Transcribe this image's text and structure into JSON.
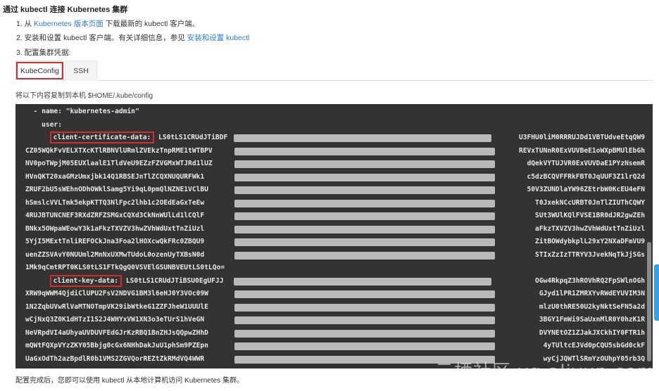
{
  "heading": "通过 kubectl 连接 Kubernetes 集群",
  "steps": [
    {
      "prefix": "1. 从 ",
      "link": "Kubernetes 版本页面",
      "suffix": " 下载最新的 kubectl 客户端。"
    },
    {
      "prefix": "2. 安装和设置 kubectl 客户端。有关详细信息，参见 ",
      "link": "安装和设置 kubectl",
      "suffix": ""
    },
    {
      "prefix": "3. 配置集群凭据:",
      "link": "",
      "suffix": ""
    }
  ],
  "tabs": [
    {
      "label": "KubeConfig",
      "active": true
    },
    {
      "label": "SSH",
      "active": false
    }
  ],
  "copy_hint": "将以下内容复制到本机 $HOME/.kube/config",
  "code": {
    "lines": [
      {
        "pre": "  - name: \"kubernetes-admin\"",
        "key": "",
        "start": "",
        "end": ""
      },
      {
        "pre": "    user:",
        "key": "",
        "start": "",
        "end": ""
      },
      {
        "pre": "      ",
        "key": "client-certificate-data:",
        "start": " LS0tLS1CRUdJTiBDF",
        "end": "U3FHU0liM0RRRUJDd1VBTUdveEtqQW9"
      },
      {
        "pre": "",
        "key": "",
        "start": "CZ05WQkFvVELXTXcKTlRBNVlURmlZVEkzTnpRME1tWTBPV",
        "end": "REVxTUNnR0ExVUVBeE1oWXpBMUlEbGh"
      },
      {
        "pre": "",
        "key": "",
        "start": "NV0poTWpjM05EUXlaalE1TldVeU9EZzFZVGMxWTJRd1lUZ",
        "end": "dQekVYTUJVR0ExVUVDaE1PYzNsemR"
      },
      {
        "pre": "",
        "key": "",
        "start": "HVnQKT20xaGMzUmxjbk14Q1RBSEJnTlZCQXNUQURFWk1",
        "end": "c5dzBCQVFFRkFBT0JqUUF3Z1lrQ2d"
      },
      {
        "pre": "",
        "key": "",
        "start": "ZRUF2bU5sWEhnODhOWklSamg5Yi9qL0pmQlNZNE1VClBU",
        "end": "50V3ZUNDlaYW96ZEtrbW0KcEU4eFN"
      },
      {
        "pre": "",
        "key": "",
        "start": "hSmslcVVLTmk5ekpKTTQ3NlFpc2lhb1c2OEdEaGxTeEw",
        "end": "T0JxekNCcURBT0JnTlZIUThCQWY"
      },
      {
        "pre": "",
        "key": "",
        "start": "4RUJBTUNCNEF3RXdZRFZSMGxCQXd3CkNnWUlLd1lCQlF",
        "end": "SUt3WUlKQlFVSE1BR0dJR2gwZEh"
      },
      {
        "pre": "",
        "key": "",
        "start": "BNkx5OWpaWEowY3k1aFkzTXVZV3hwZVhWdUxtTnZiUzl",
        "end": "aFkzTXVZV3hwZVhWdUxtTnZiUzl"
      },
      {
        "pre": "",
        "key": "",
        "start": "5YjI5MExtTnliREFOCkJna3Foa2lHOXcwQkFRc0ZBQU9",
        "end": "ZitBOWdybkplL29xY2NXaDFmVU9"
      },
      {
        "pre": "",
        "key": "",
        "start": "uenZZSVAvY0NUUml2MnNxUXMwTUdoL0ozenUyTXBsN0d",
        "end": "STIxZzIzTTRYV3JvekNqTkJjSGs"
      },
      {
        "pre": "",
        "key": "",
        "start": "1Mk9qCmtRPT0KLS0tLS1FTkQgQ0VSVElGSUNBVEUtLS0tLQo=",
        "end": ""
      },
      {
        "pre": "      ",
        "key": "client-key-data:",
        "start": " LS0tLS1CRUdJTiBSU0EgUFJJ",
        "end": "OGw4RkpqZ3hROVhRQ2FpSWlnOGh"
      },
      {
        "pre": "",
        "key": "",
        "start": "XRW9qWWM4QjdiClUPU2FsV2NDVG1BM3l6eHJ0Y3VOc09W",
        "end": "GJyd1lPR1ZMRXYvRWdEYUVIM3N"
      },
      {
        "pre": "",
        "key": "",
        "start": "1N2ZqbUVwRlVaMTNOTmpVK29ibWtkeG1ZZFJheW1UUUlE",
        "end": "mlzU0thRE50U2kyNktSeFN5a2d"
      },
      {
        "pre": "",
        "key": "",
        "start": "wCjNxQ3Z0K1dHTzI1S2J4WHYxVW1XN3o3eTUrS1hVeGN",
        "end": "3BGY1FmWi9SaUxnMlR0Y0hzK1R"
      },
      {
        "pre": "",
        "key": "",
        "start": "NeVRpdVI4aUhyaUVDUVFEdGJrKzRBQ1BnZHJsQQpwZHhD",
        "end": "DVYNEtOZ1ZJakJXCkhIY0FTR1h"
      },
      {
        "pre": "",
        "key": "",
        "start": "mQWtFQXpVYzZKY05Bbjg0cGx6NHhDakJuU1phSm9PZEpn",
        "end": "4yTUltcEJVd0pCQU5sbGd0ckF"
      },
      {
        "pre": "",
        "key": "",
        "start": "UaGxOdTh2azBpdlR0b1VMS2ZGVQorREZtZkRMdVQ4WWR",
        "end": "wyCjJQWTlSRmYzOUhpY05rb3Q"
      }
    ]
  },
  "watermark": "云栖社区 yq.aliyun.com",
  "footer": "配置完成后，您即可以使用 kubectl 从本地计算机访问 Kubernetes 集群。"
}
